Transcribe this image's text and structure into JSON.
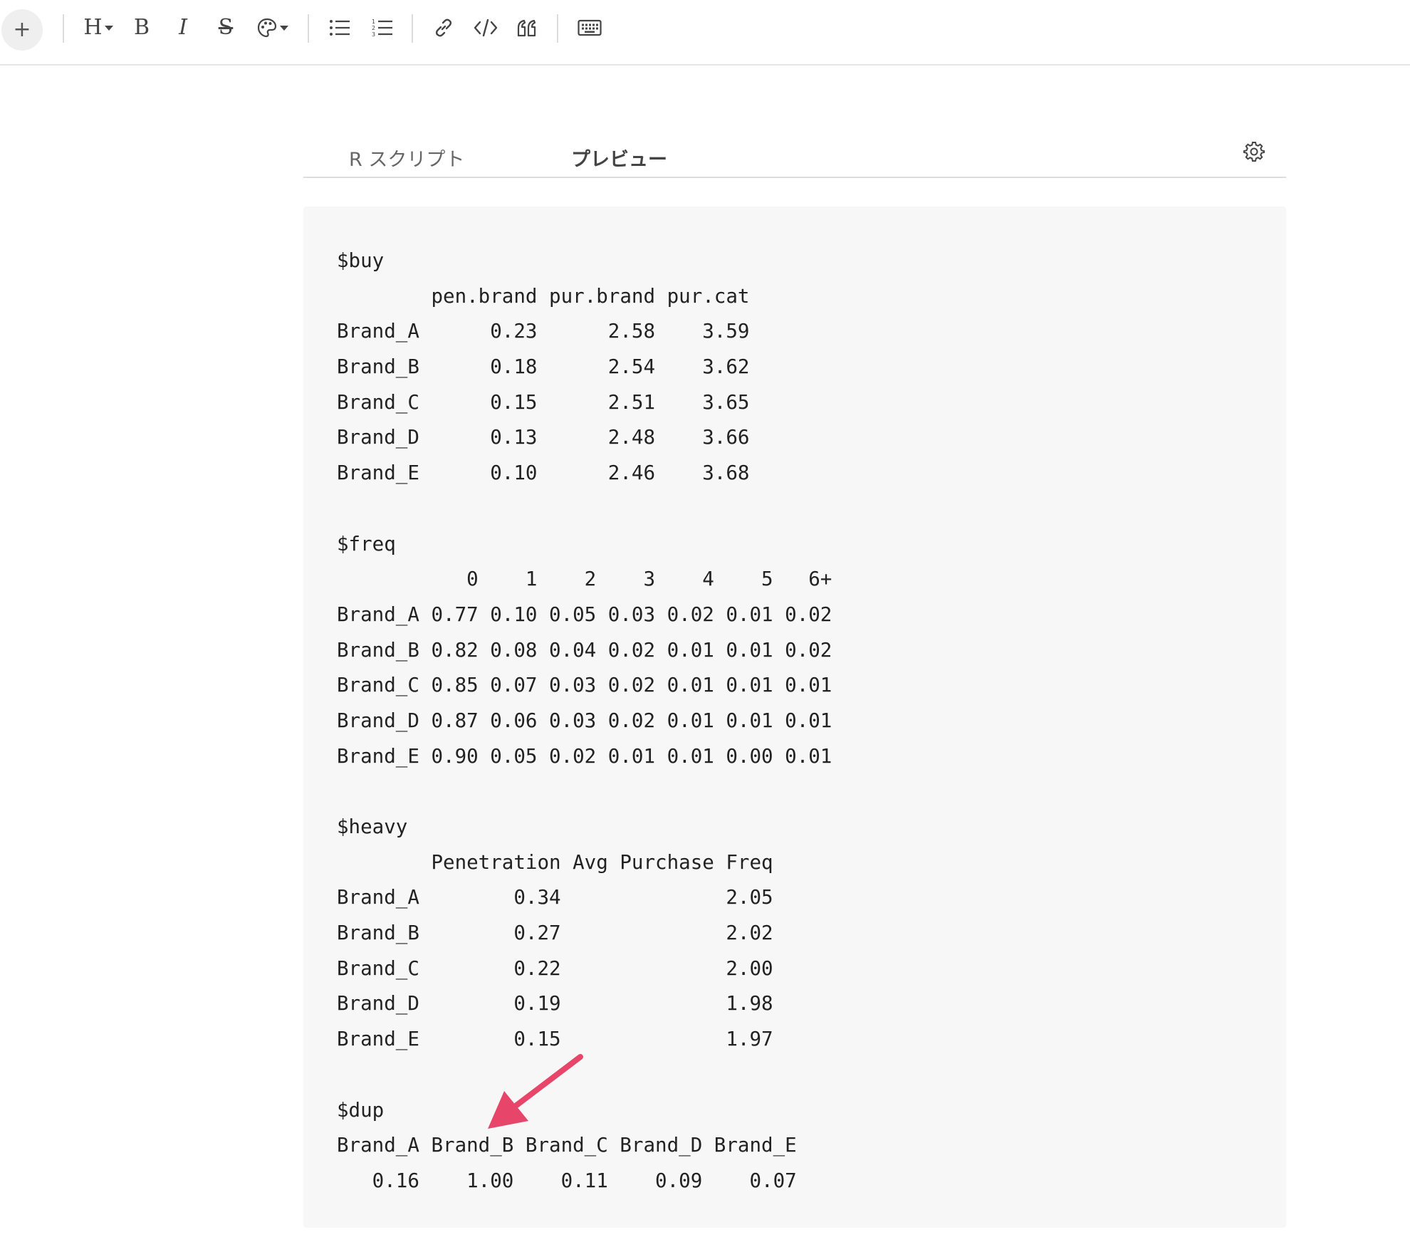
{
  "toolbar": {
    "plus_label": "+",
    "heading_label": "H",
    "bold_label": "B",
    "italic_label": "I",
    "strike_label": "S",
    "icons": [
      "plus-icon",
      "heading-icon",
      "bold-icon",
      "italic-icon",
      "strikethrough-icon",
      "palette-icon",
      "bullet-list-icon",
      "numbered-list-icon",
      "link-icon",
      "code-icon",
      "quote-icon",
      "keyboard-icon"
    ]
  },
  "tabs": {
    "r_script": "R スクリプト",
    "preview": "プレビュー",
    "settings_icon": "gear-icon"
  },
  "output": {
    "lines": [
      "$buy",
      "        pen.brand pur.brand pur.cat",
      "Brand_A      0.23      2.58    3.59",
      "Brand_B      0.18      2.54    3.62",
      "Brand_C      0.15      2.51    3.65",
      "Brand_D      0.13      2.48    3.66",
      "Brand_E      0.10      2.46    3.68",
      "",
      "$freq",
      "           0    1    2    3    4    5   6+",
      "Brand_A 0.77 0.10 0.05 0.03 0.02 0.01 0.02",
      "Brand_B 0.82 0.08 0.04 0.02 0.01 0.01 0.02",
      "Brand_C 0.85 0.07 0.03 0.02 0.01 0.01 0.01",
      "Brand_D 0.87 0.06 0.03 0.02 0.01 0.01 0.01",
      "Brand_E 0.90 0.05 0.02 0.01 0.01 0.00 0.01",
      "",
      "$heavy",
      "        Penetration Avg Purchase Freq",
      "Brand_A        0.34              2.05",
      "Brand_B        0.27              2.02",
      "Brand_C        0.22              2.00",
      "Brand_D        0.19              1.98",
      "Brand_E        0.15              1.97",
      "",
      "$dup",
      "Brand_A Brand_B Brand_C Brand_D Brand_E",
      "   0.16    1.00    0.11    0.09    0.07"
    ]
  },
  "annotation": {
    "arrow_color": "#e8456b"
  },
  "colors": {
    "panel_bg": "#f7f7f7",
    "icon": "#444444"
  }
}
